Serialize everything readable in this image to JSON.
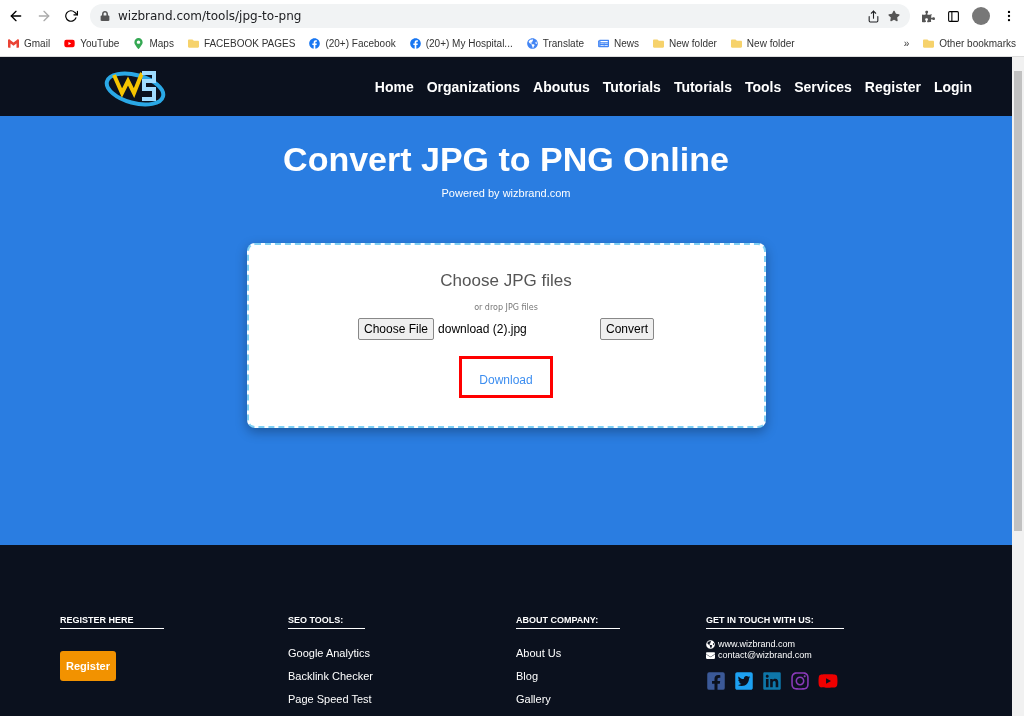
{
  "browser": {
    "url": "wizbrand.com/tools/jpg-to-png",
    "bookmarks": [
      {
        "label": "Gmail",
        "kind": "gmail"
      },
      {
        "label": "YouTube",
        "kind": "youtube"
      },
      {
        "label": "Maps",
        "kind": "maps"
      },
      {
        "label": "FACEBOOK PAGES",
        "kind": "folder"
      },
      {
        "label": "(20+) Facebook",
        "kind": "facebook"
      },
      {
        "label": "(20+) My Hospital...",
        "kind": "facebook"
      },
      {
        "label": "Translate",
        "kind": "translate"
      },
      {
        "label": "News",
        "kind": "news"
      },
      {
        "label": "New folder",
        "kind": "folder"
      },
      {
        "label": "New folder",
        "kind": "folder"
      }
    ],
    "more": "»",
    "other_bookmarks": "Other bookmarks"
  },
  "nav": {
    "items": [
      "Home",
      "Organizations",
      "Aboutus",
      "Tutorials",
      "Tutorials",
      "Tools",
      "Services",
      "Register",
      "Login"
    ]
  },
  "hero": {
    "title": "Convert JPG to PNG Online",
    "subtitle": "Powered by wizbrand.com"
  },
  "upload": {
    "heading": "Choose JPG files",
    "hint": "or drop JPG files",
    "choose_button": "Choose File",
    "file_name": "download (2).jpg",
    "convert_button": "Convert",
    "download_link": "Download"
  },
  "footer": {
    "columns": [
      {
        "heading": "REGISTER HERE",
        "button": "Register"
      },
      {
        "heading": "SEO TOOLS:",
        "links": [
          "Google Analytics",
          "Backlink Checker",
          "Page Speed Test"
        ]
      },
      {
        "heading": "ABOUT COMPANY:",
        "links": [
          "About Us",
          "Blog",
          "Gallery"
        ]
      },
      {
        "heading": "GET IN TOUCH WITH US:",
        "contacts": [
          {
            "kind": "web",
            "text": "www.wizbrand.com"
          },
          {
            "kind": "mail",
            "text": "contact@wizbrand.com"
          }
        ],
        "social": [
          {
            "kind": "facebook"
          },
          {
            "kind": "twitter"
          },
          {
            "kind": "linkedin"
          },
          {
            "kind": "instagram"
          },
          {
            "kind": "youtube"
          }
        ]
      }
    ]
  }
}
